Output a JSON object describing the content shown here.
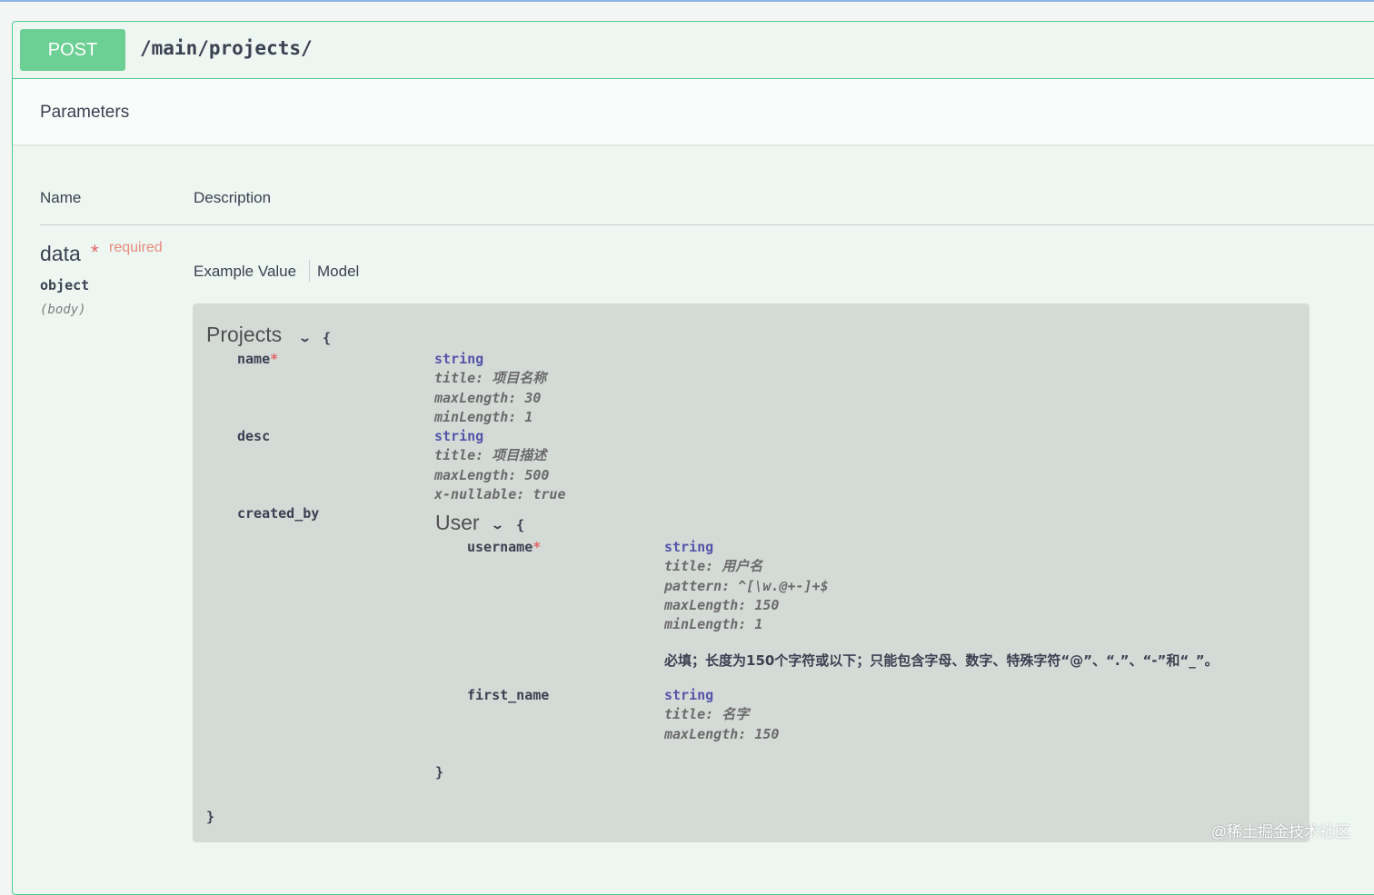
{
  "operation": {
    "method": "POST",
    "path": "/main/projects/"
  },
  "section": {
    "title": "Parameters"
  },
  "columns": {
    "name": "Name",
    "description": "Description"
  },
  "parameter": {
    "name": "data",
    "required_star": "*",
    "required_label": "required",
    "type": "object",
    "in": "(body)"
  },
  "tabs": {
    "example": "Example Value",
    "model": "Model",
    "active": "Model"
  },
  "model": {
    "title": "Projects",
    "open_brace": "{",
    "close_brace": "}",
    "props": [
      {
        "name": "name",
        "required": "*",
        "type": "string",
        "meta": [
          "title: 项目名称",
          "maxLength: 30",
          "minLength: 1"
        ]
      },
      {
        "name": "desc",
        "type": "string",
        "meta": [
          "title: 项目描述",
          "maxLength: 500",
          "x-nullable: true"
        ]
      },
      {
        "name": "created_by"
      }
    ],
    "nested": {
      "title": "User",
      "open_brace": "{",
      "close_brace": "}",
      "props": [
        {
          "name": "username",
          "required": "*",
          "type": "string",
          "meta": [
            "title: 用户名",
            "pattern: ^[\\w.@+-]+$",
            "maxLength: 150",
            "minLength: 1"
          ],
          "description": "必填；长度为150个字符或以下；只能包含字母、数字、特殊字符“@”、“.”、“-”和“_”。"
        },
        {
          "name": "first_name",
          "type": "string",
          "meta": [
            "title: 名字",
            "maxLength: 150"
          ]
        }
      ]
    }
  },
  "watermark": "@稀土掘金技术社区",
  "colors": {
    "post": "#49cc90",
    "type": "#5555aa",
    "required": "#e06666"
  }
}
